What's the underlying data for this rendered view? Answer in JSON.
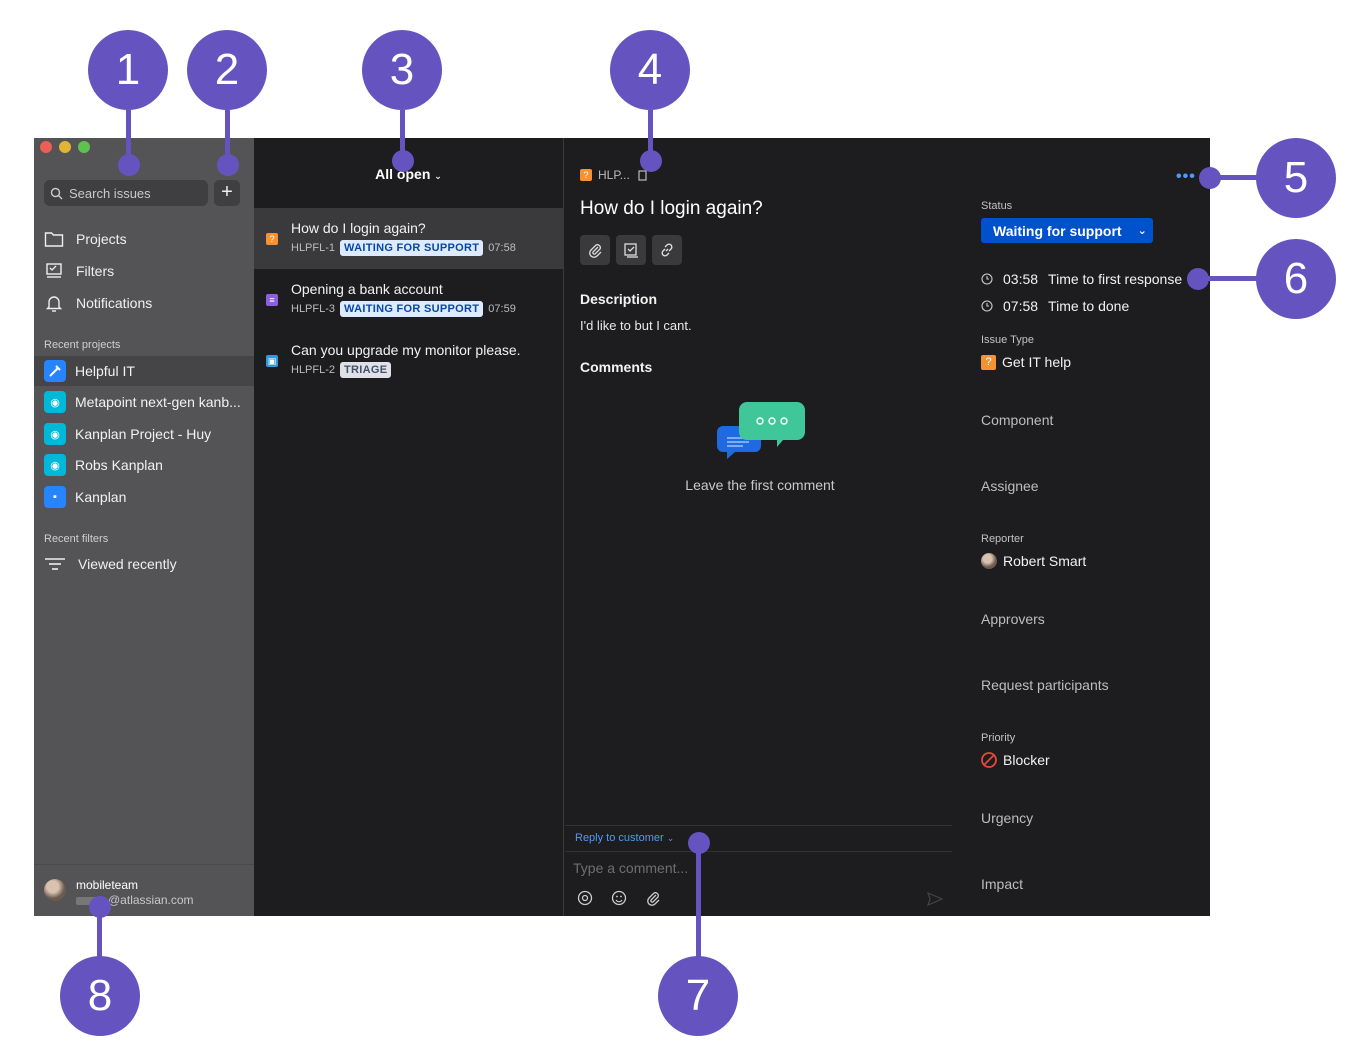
{
  "colors": {
    "accent": "#0052cc",
    "callout": "#6554c0",
    "link": "#4c9aff"
  },
  "sidebar": {
    "search_placeholder": "Search issues",
    "add_label": "+",
    "nav": [
      {
        "label": "Projects",
        "icon": "folder-icon"
      },
      {
        "label": "Filters",
        "icon": "filter-icon"
      },
      {
        "label": "Notifications",
        "icon": "bell-icon"
      }
    ],
    "recent_projects_label": "Recent projects",
    "projects": [
      {
        "label": "Helpful IT",
        "active": true
      },
      {
        "label": "Metapoint next-gen kanb..."
      },
      {
        "label": "Kanplan Project - Huy"
      },
      {
        "label": "Robs Kanplan"
      },
      {
        "label": "Kanplan"
      }
    ],
    "recent_filters_label": "Recent filters",
    "filters": [
      {
        "label": "Viewed recently"
      }
    ],
    "user": {
      "name": "mobileteam",
      "email": "@atlassian.com"
    }
  },
  "list": {
    "title": "All open",
    "issues": [
      {
        "title": "How do I login again?",
        "key": "HLPFL-1",
        "status": "WAITING FOR SUPPORT",
        "time": "07:58",
        "type_color": "#f79232",
        "type_glyph": "?"
      },
      {
        "title": "Opening a bank account",
        "key": "HLPFL-3",
        "status": "WAITING FOR SUPPORT",
        "time": "07:59",
        "type_color": "#8b5fe0",
        "type_glyph": "≡"
      },
      {
        "title": "Can you upgrade my monitor please.",
        "key": "HLPFL-2",
        "status": "TRIAGE",
        "time": "",
        "type_color": "#2d9cdb",
        "type_glyph": "▣"
      }
    ]
  },
  "detail": {
    "breadcrumb": "HLP...",
    "title": "How do I login again?",
    "description_label": "Description",
    "description": "I'd like to but I cant.",
    "comments_label": "Comments",
    "empty_comments": "Leave the first comment",
    "reply_label": "Reply to customer",
    "comment_placeholder": "Type a comment...",
    "more": "•••",
    "status_label": "Status",
    "status_value": "Waiting for support",
    "sla": [
      {
        "time": "03:58",
        "label": "Time to first response"
      },
      {
        "time": "07:58",
        "label": "Time to done"
      }
    ],
    "issue_type_label": "Issue Type",
    "issue_type_value": "Get IT help",
    "component_label": "Component",
    "assignee_label": "Assignee",
    "reporter_label": "Reporter",
    "reporter_value": "Robert Smart",
    "approvers_label": "Approvers",
    "participants_label": "Request participants",
    "priority_label": "Priority",
    "priority_value": "Blocker",
    "urgency_label": "Urgency",
    "impact_label": "Impact"
  },
  "callouts": [
    "1",
    "2",
    "3",
    "4",
    "5",
    "6",
    "7",
    "8"
  ]
}
